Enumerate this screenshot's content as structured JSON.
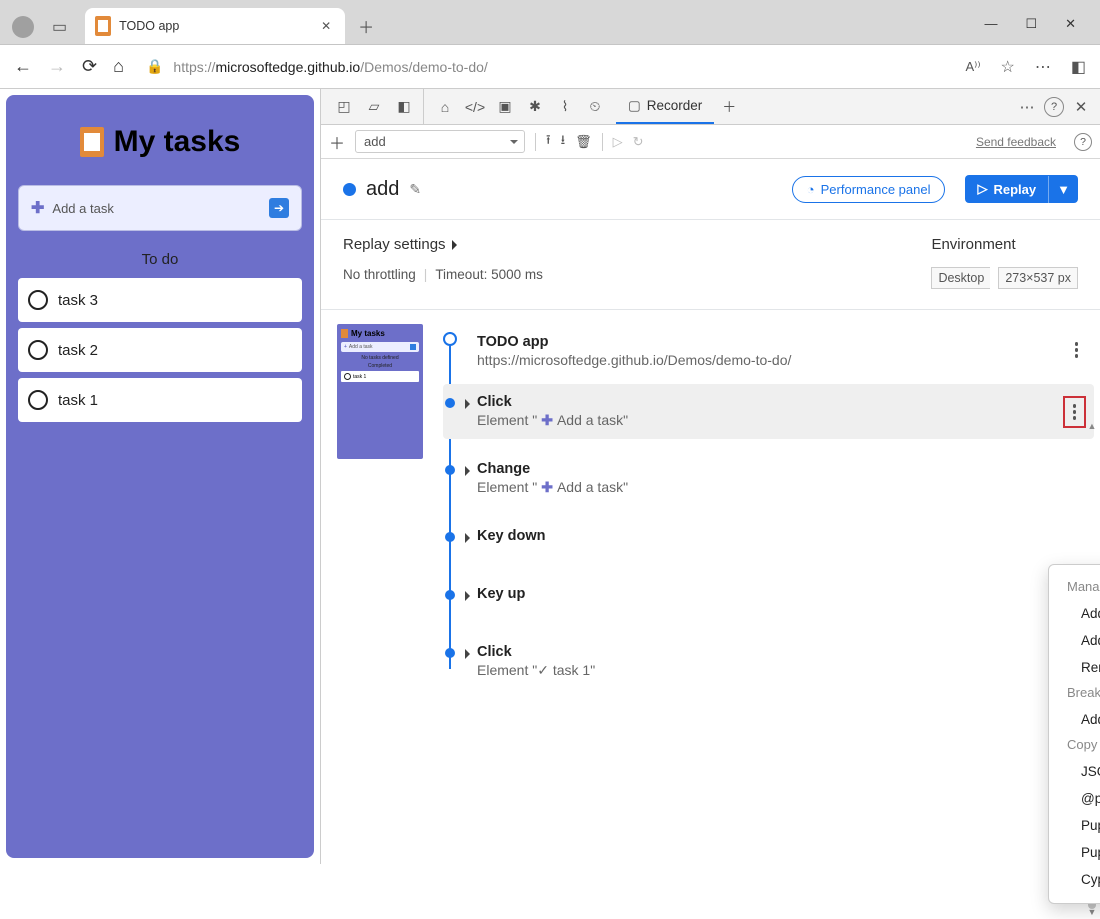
{
  "browser": {
    "tab_title": "TODO app",
    "url_host": "microsoftedge.github.io",
    "url_path": "/Demos/demo-to-do/",
    "url_scheme": "https://"
  },
  "app": {
    "title": "My tasks",
    "add_placeholder": "Add a task",
    "section_label": "To do",
    "tasks": [
      "task 3",
      "task 2",
      "task 1"
    ]
  },
  "devtools": {
    "active_tool": "Recorder",
    "recording_dd": "add",
    "feedback": "Send feedback",
    "recording_name": "add",
    "perf_button": "Performance panel",
    "replay_button": "Replay",
    "replay_settings_label": "Replay settings",
    "throttling": "No throttling",
    "timeout": "Timeout: 5000 ms",
    "env_label": "Environment",
    "env_device": "Desktop",
    "env_size": "273×537 px"
  },
  "steps": {
    "s0_title": "TODO app",
    "s0_sub": "https://microsoftedge.github.io/Demos/demo-to-do/",
    "s1_title": "Click",
    "s1_sub_pre": "Element \"",
    "s1_sub_mid": "Add a task",
    "s1_sub_post": "\"",
    "s2_title": "Change",
    "s2_sub_pre": "Element \"",
    "s2_sub_mid": "Add a task",
    "s2_sub_post": "\"",
    "s3_title": "Key down",
    "s4_title": "Key up",
    "s5_title": "Click",
    "s5_sub": "Element \"✓ task 1\""
  },
  "ctx": {
    "hdr1": "Manage steps",
    "i1": "Add step before",
    "i2": "Add step after",
    "i3": "Remove step",
    "hdr2": "Breakpoints",
    "i4": "Add breakpoint",
    "hdr3": "Copy as",
    "i5": "JSON",
    "i6": "@puppeteer/replay",
    "i7": "Puppeteer",
    "i8": "Puppeteer (including Lighthouse analysis)",
    "i9": "Cypress Test"
  },
  "thumb": {
    "title": "My tasks",
    "add": "Add a task",
    "nolabel": "No tasks defined",
    "completed": "Completed",
    "task": "task 1"
  }
}
